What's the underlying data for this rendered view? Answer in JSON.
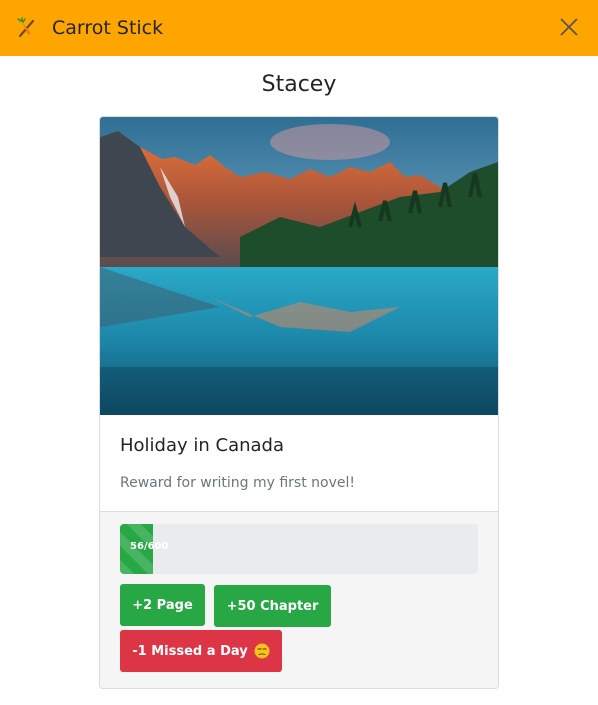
{
  "app": {
    "name": "Carrot Stick",
    "logo_icon": "carrot-stick-icon",
    "close_icon": "close-icon"
  },
  "user": {
    "name": "Stacey"
  },
  "card": {
    "image": "mountain-lake-photo",
    "title": "Holiday in Canada",
    "description": "Reward for writing my first novel!",
    "progress": {
      "label": "56/600",
      "current": 56,
      "total": 600
    },
    "actions": [
      {
        "label": "+2 Page"
      },
      {
        "label": "+50 Chapter"
      },
      {
        "label": "-1 Missed a Day",
        "icon": "unamused-face-emoji"
      }
    ]
  },
  "colors": {
    "header": "#ffa500",
    "success": "#28a745",
    "danger": "#dc3545",
    "progress_track": "#e9ecef",
    "footer": "#f5f5f5"
  }
}
